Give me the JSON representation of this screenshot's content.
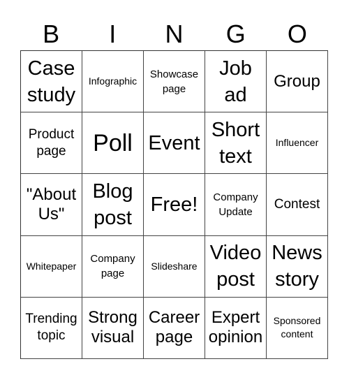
{
  "header": {
    "letters": [
      "B",
      "I",
      "N",
      "G",
      "O"
    ]
  },
  "cells": [
    [
      {
        "text": "Case study",
        "size": "s-lg"
      },
      {
        "text": "Infographic",
        "size": "s-xxs"
      },
      {
        "text": "Showcase page",
        "size": "s-xs"
      },
      {
        "text": "Job ad",
        "size": "s-lg"
      },
      {
        "text": "Group",
        "size": "s-md"
      }
    ],
    [
      {
        "text": "Product page",
        "size": "s-sm"
      },
      {
        "text": "Poll",
        "size": "s-xl"
      },
      {
        "text": "Event",
        "size": "s-lg"
      },
      {
        "text": "Short text",
        "size": "s-lg"
      },
      {
        "text": "Influencer",
        "size": "s-xxs"
      }
    ],
    [
      {
        "text": "\"About Us\"",
        "size": "s-md"
      },
      {
        "text": "Blog post",
        "size": "s-lg"
      },
      {
        "text": "Free!",
        "size": "s-lg"
      },
      {
        "text": "Company Update",
        "size": "s-xs"
      },
      {
        "text": "Contest",
        "size": "s-sm"
      }
    ],
    [
      {
        "text": "Whitepaper",
        "size": "s-xxs"
      },
      {
        "text": "Company page",
        "size": "s-xs"
      },
      {
        "text": "Slideshare",
        "size": "s-xxs"
      },
      {
        "text": "Video post",
        "size": "s-lg"
      },
      {
        "text": "News story",
        "size": "s-lg"
      }
    ],
    [
      {
        "text": "Trending topic",
        "size": "s-sm"
      },
      {
        "text": "Strong visual",
        "size": "s-md"
      },
      {
        "text": "Career page",
        "size": "s-md"
      },
      {
        "text": "Expert opinion",
        "size": "s-md"
      },
      {
        "text": "Sponsored content",
        "size": "s-xxs"
      }
    ]
  ]
}
